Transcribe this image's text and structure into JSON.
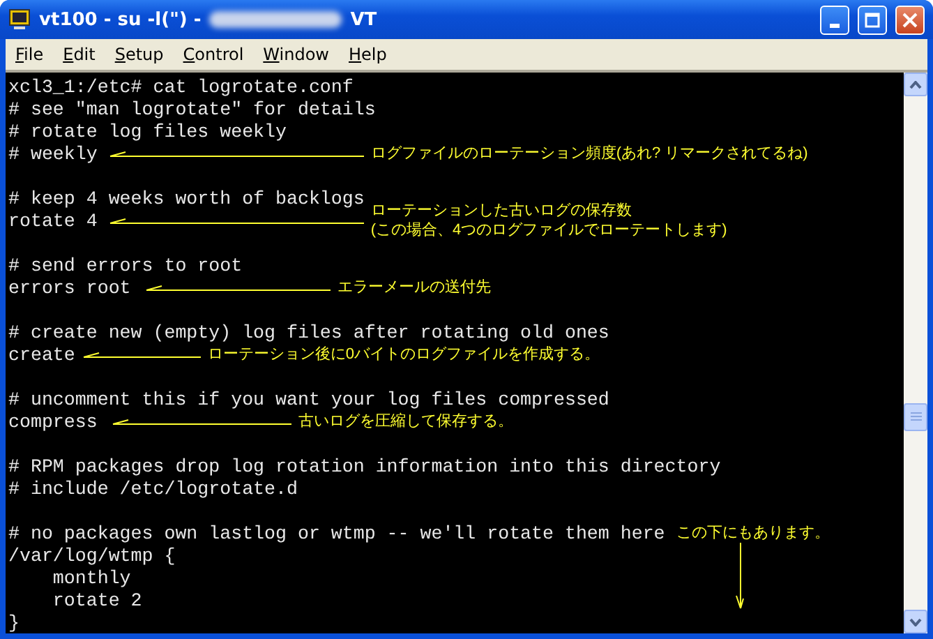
{
  "window": {
    "title": "vt100 - su -l(\") -",
    "title_suffix": "VT"
  },
  "menu": [
    "File",
    "Edit",
    "Setup",
    "Control",
    "Window",
    "Help"
  ],
  "terminal": {
    "lines": [
      {
        "kind": "text",
        "text": "xcl3_1:/etc# cat logrotate.conf"
      },
      {
        "kind": "text",
        "text": "# see \"man logrotate\" for details"
      },
      {
        "kind": "text",
        "text": "# rotate log files weekly"
      },
      {
        "kind": "text",
        "text": "# weekly",
        "annotation": {
          "kind": "left",
          "lines": [
            "ログファイルのローテーション頻度(あれ? リマークされてるね)"
          ]
        }
      },
      {
        "kind": "blank"
      },
      {
        "kind": "text",
        "text": "# keep 4 weeks worth of backlogs"
      },
      {
        "kind": "text",
        "text": "rotate 4",
        "annotation": {
          "kind": "left",
          "lines": [
            "ローテーションした古いログの保存数",
            "(この場合、4つのログファイルでローテートします)"
          ]
        }
      },
      {
        "kind": "blank"
      },
      {
        "kind": "text",
        "text": "# send errors to root"
      },
      {
        "kind": "text",
        "text": "errors root",
        "annotation": {
          "kind": "left",
          "lines": [
            "エラーメールの送付先"
          ]
        }
      },
      {
        "kind": "blank"
      },
      {
        "kind": "text",
        "text": "# create new (empty) log files after rotating old ones"
      },
      {
        "kind": "text",
        "text": "create",
        "annotation": {
          "kind": "left",
          "lines": [
            "ローテーション後に0バイトのログファイルを作成する。"
          ]
        }
      },
      {
        "kind": "blank"
      },
      {
        "kind": "text",
        "text": "# uncomment this if you want your log files compressed"
      },
      {
        "kind": "text",
        "text": "compress",
        "annotation": {
          "kind": "left",
          "lines": [
            "古いログを圧縮して保存する。"
          ]
        }
      },
      {
        "kind": "blank"
      },
      {
        "kind": "text",
        "text": "# RPM packages drop log rotation information into this directory"
      },
      {
        "kind": "text",
        "text": "# include /etc/logrotate.d"
      },
      {
        "kind": "blank"
      },
      {
        "kind": "text",
        "text": "# no packages own lastlog or wtmp -- we'll rotate them here",
        "annotation": {
          "kind": "down",
          "lines": [
            "この下にもあります。"
          ]
        }
      },
      {
        "kind": "text",
        "text": "/var/log/wtmp {"
      },
      {
        "kind": "text",
        "text": "    monthly"
      },
      {
        "kind": "text",
        "text": "    rotate 2"
      },
      {
        "kind": "text",
        "text": "}"
      }
    ]
  }
}
